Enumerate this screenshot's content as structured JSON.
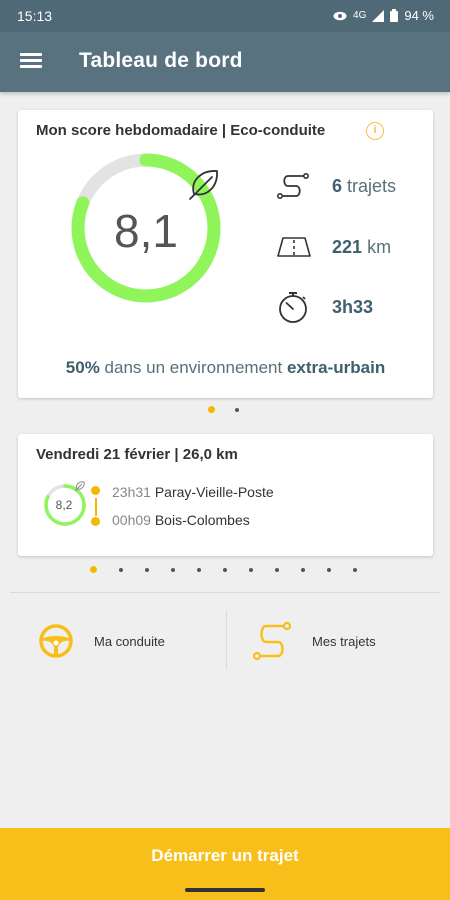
{
  "status_bar": {
    "time": "15:13",
    "network": "4G",
    "battery": "94 %"
  },
  "app_bar": {
    "title": "Tableau de bord"
  },
  "weekly_score": {
    "heading": "Mon score hebdomadaire | Eco-conduite",
    "score": "8,1",
    "score_fraction": 0.81,
    "trips_count": "6",
    "trips_unit": "trajets",
    "distance_value": "221",
    "distance_unit": "km",
    "duration": "3h33",
    "env_percent": "50%",
    "env_text": "dans un environnement",
    "env_type": "extra-urbain"
  },
  "last_trip": {
    "heading": "Vendredi 21 février | 26,0 km",
    "score": "8,2",
    "score_fraction": 0.82,
    "start_time": "23h31",
    "start_place": "Paray-Vieille-Poste",
    "end_time": "00h09",
    "end_place": "Bois-Colombes"
  },
  "pager": {
    "top_count": 2,
    "bottom_count": 11
  },
  "nav": {
    "conduite_label": "Ma conduite",
    "trajets_label": "Mes trajets"
  },
  "cta": {
    "label": "Démarrer un trajet"
  },
  "colors": {
    "accent": "#f8bf1b",
    "gauge": "#8ff55a",
    "header": "#58727f"
  }
}
